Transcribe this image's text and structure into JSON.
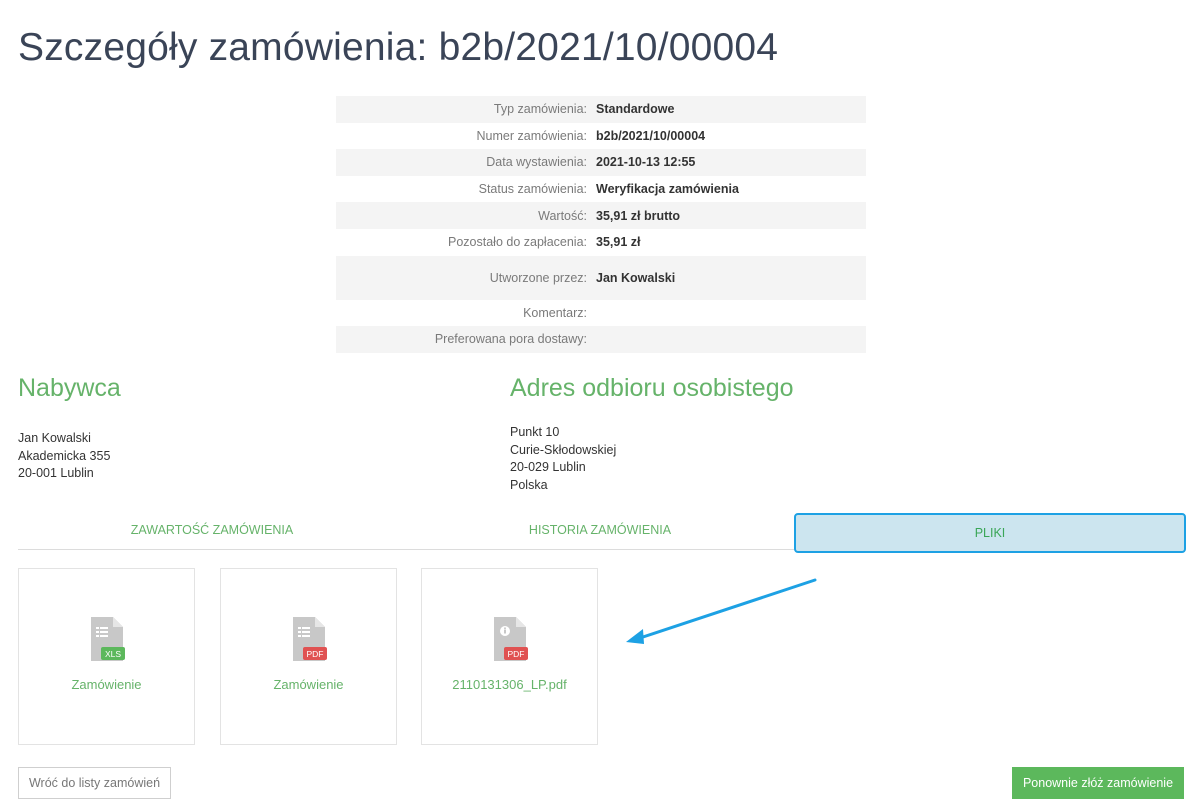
{
  "page_title": "Szczegóły zamówienia: b2b/2021/10/00004",
  "details": [
    {
      "label": "Typ zamówienia:",
      "value": "Standardowe"
    },
    {
      "label": "Numer zamówienia:",
      "value": "b2b/2021/10/00004"
    },
    {
      "label": "Data wystawienia:",
      "value": "2021-10-13 12:55"
    },
    {
      "label": "Status zamówienia:",
      "value": "Weryfikacja zamówienia"
    },
    {
      "label": "Wartość:",
      "value": "35,91 zł brutto"
    },
    {
      "label": "Pozostało do zapłacenia:",
      "value": "35,91 zł"
    },
    {
      "label": "Utworzone przez:",
      "value": "Jan Kowalski"
    },
    {
      "label": "Komentarz:",
      "value": ""
    },
    {
      "label": "Preferowana pora dostawy:",
      "value": ""
    }
  ],
  "buyer": {
    "title": "Nabywca",
    "lines": [
      "Jan Kowalski",
      "Akademicka 355",
      "20-001 Lublin"
    ]
  },
  "pickup": {
    "title": "Adres odbioru osobistego",
    "lines": [
      "Punkt 10",
      "Curie-Skłodowskiej",
      "20-029 Lublin",
      "Polska"
    ]
  },
  "tabs": [
    {
      "label": "ZAWARTOŚĆ ZAMÓWIENIA",
      "active": false
    },
    {
      "label": "HISTORIA ZAMÓWIENIA",
      "active": false
    },
    {
      "label": "PLIKI",
      "active": true
    }
  ],
  "files": [
    {
      "name": "Zamówienie",
      "type": "XLS",
      "badge_color": "#5cb85c",
      "icon": "spreadsheet-file-icon"
    },
    {
      "name": "Zamówienie",
      "type": "PDF",
      "badge_color": "#e05252",
      "icon": "document-file-icon"
    },
    {
      "name": "2110131306_LP.pdf",
      "type": "PDF",
      "badge_color": "#e05252",
      "icon": "info-file-icon"
    }
  ],
  "buttons": {
    "back": "Wróć do listy zamówień",
    "reorder": "Ponownie złóż zamówienie"
  },
  "colors": {
    "accent_green": "#66b36a",
    "button_green": "#5cb85c",
    "highlight_blue": "#1da1e4",
    "highlight_fill": "#cce5ef"
  }
}
